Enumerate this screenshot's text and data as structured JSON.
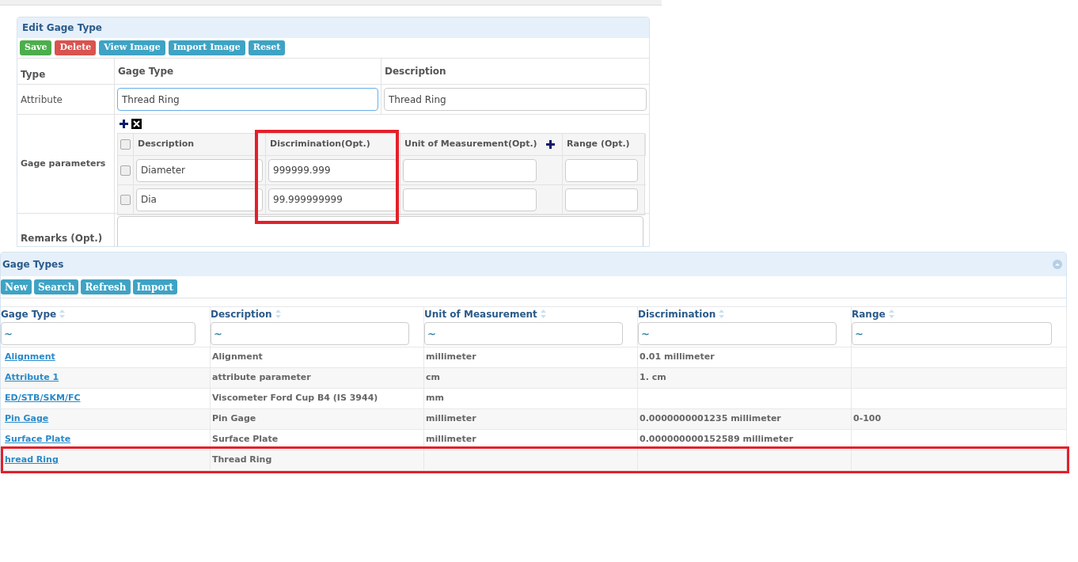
{
  "edit_panel": {
    "title": "Edit Gage Type",
    "buttons": [
      {
        "label": "Save",
        "kind": "success"
      },
      {
        "label": "Delete",
        "kind": "danger"
      },
      {
        "label": "View Image",
        "kind": "info"
      },
      {
        "label": "Import Image",
        "kind": "info"
      },
      {
        "label": "Reset",
        "kind": "info"
      }
    ],
    "type_label": "Type",
    "type_value": "Attribute",
    "gage_type_label": "Gage Type",
    "gage_type_value": "Thread Ring",
    "description_label": "Description",
    "description_value": "Thread Ring",
    "parameters_label": "Gage parameters",
    "parameters": {
      "columns": [
        {
          "label": "Description",
          "highlighted": false
        },
        {
          "label": "Discrimination(Opt.)",
          "highlighted": true
        },
        {
          "label": "Unit of Measurement(Opt.)",
          "highlighted": false
        },
        {
          "label": "Range (Opt.)",
          "highlighted": false
        }
      ],
      "header_checked": false,
      "rows": [
        {
          "checked": false,
          "description": "Diameter",
          "discrimination": "999999.999"
        },
        {
          "checked": false,
          "description": "Dia",
          "discrimination": "99.999999999"
        }
      ]
    },
    "remarks_label": "Remarks (Opt.)"
  },
  "list_panel": {
    "title": "Gage Types",
    "buttons": [
      "New",
      "Search",
      "Refresh",
      "Import"
    ],
    "columns": [
      "Gage Type",
      "Description",
      "Unit of Measurement",
      "Discrimination",
      "Range"
    ],
    "filters": [
      "~",
      "~",
      "~",
      "~",
      "~"
    ],
    "rows": [
      {
        "cells": [
          "Alignment",
          "Alignment",
          "millimeter",
          "0.01 millimeter",
          ""
        ],
        "highlighted": false
      },
      {
        "cells": [
          "Attribute 1",
          "attribute parameter",
          "cm",
          "1. cm",
          ""
        ],
        "highlighted": false
      },
      {
        "cells": [
          "ED/STB/SKM/FC",
          "Viscometer Ford Cup B4 (IS 3944)",
          "mm",
          "",
          ""
        ],
        "highlighted": false
      },
      {
        "cells": [
          "Pin Gage",
          "Pin Gage",
          "millimeter",
          "0.0000000001235 millimeter",
          "0-100"
        ],
        "highlighted": false
      },
      {
        "cells": [
          "Surface Plate",
          "Surface Plate",
          "millimeter",
          "0.000000000152589 millimeter",
          ""
        ],
        "highlighted": false
      },
      {
        "cells": [
          "hread Ring",
          "Thread Ring",
          "",
          "",
          ""
        ],
        "highlighted": true
      }
    ]
  }
}
